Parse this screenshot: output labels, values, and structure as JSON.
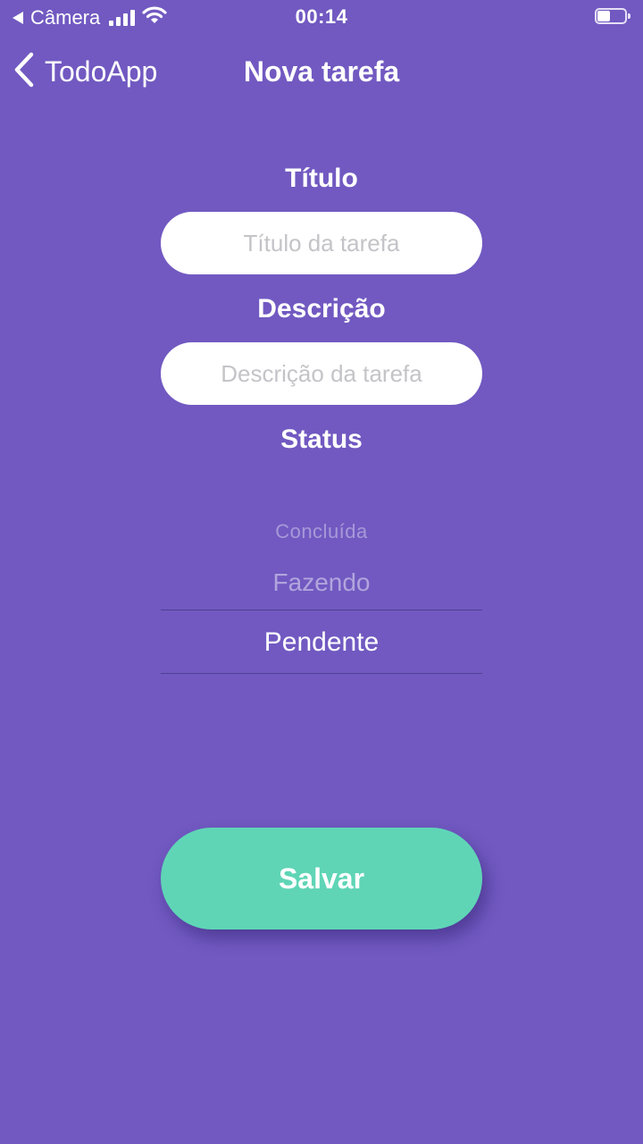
{
  "status_bar": {
    "back_app": "Câmera",
    "time": "00:14",
    "battery_level": 0.45
  },
  "nav": {
    "back_label": "TodoApp",
    "title": "Nova tarefa"
  },
  "form": {
    "title_label": "Título",
    "title_placeholder": "Título da tarefa",
    "title_value": "",
    "description_label": "Descrição",
    "description_placeholder": "Descrição da tarefa",
    "description_value": "",
    "status_label": "Status"
  },
  "status_picker": {
    "options": [
      "Concluída",
      "Fazendo",
      "Pendente"
    ],
    "selected": "Pendente"
  },
  "save_button": {
    "label": "Salvar"
  },
  "colors": {
    "background": "#7159c1",
    "accent": "#5fd5b6",
    "input_background": "#ffffff",
    "placeholder": "#c4c4c8"
  },
  "icons": {
    "status_back": "back-triangle-icon",
    "signal": "cellular-signal-icon",
    "wifi": "wifi-icon",
    "battery": "battery-icon",
    "nav_back": "chevron-left-icon"
  }
}
